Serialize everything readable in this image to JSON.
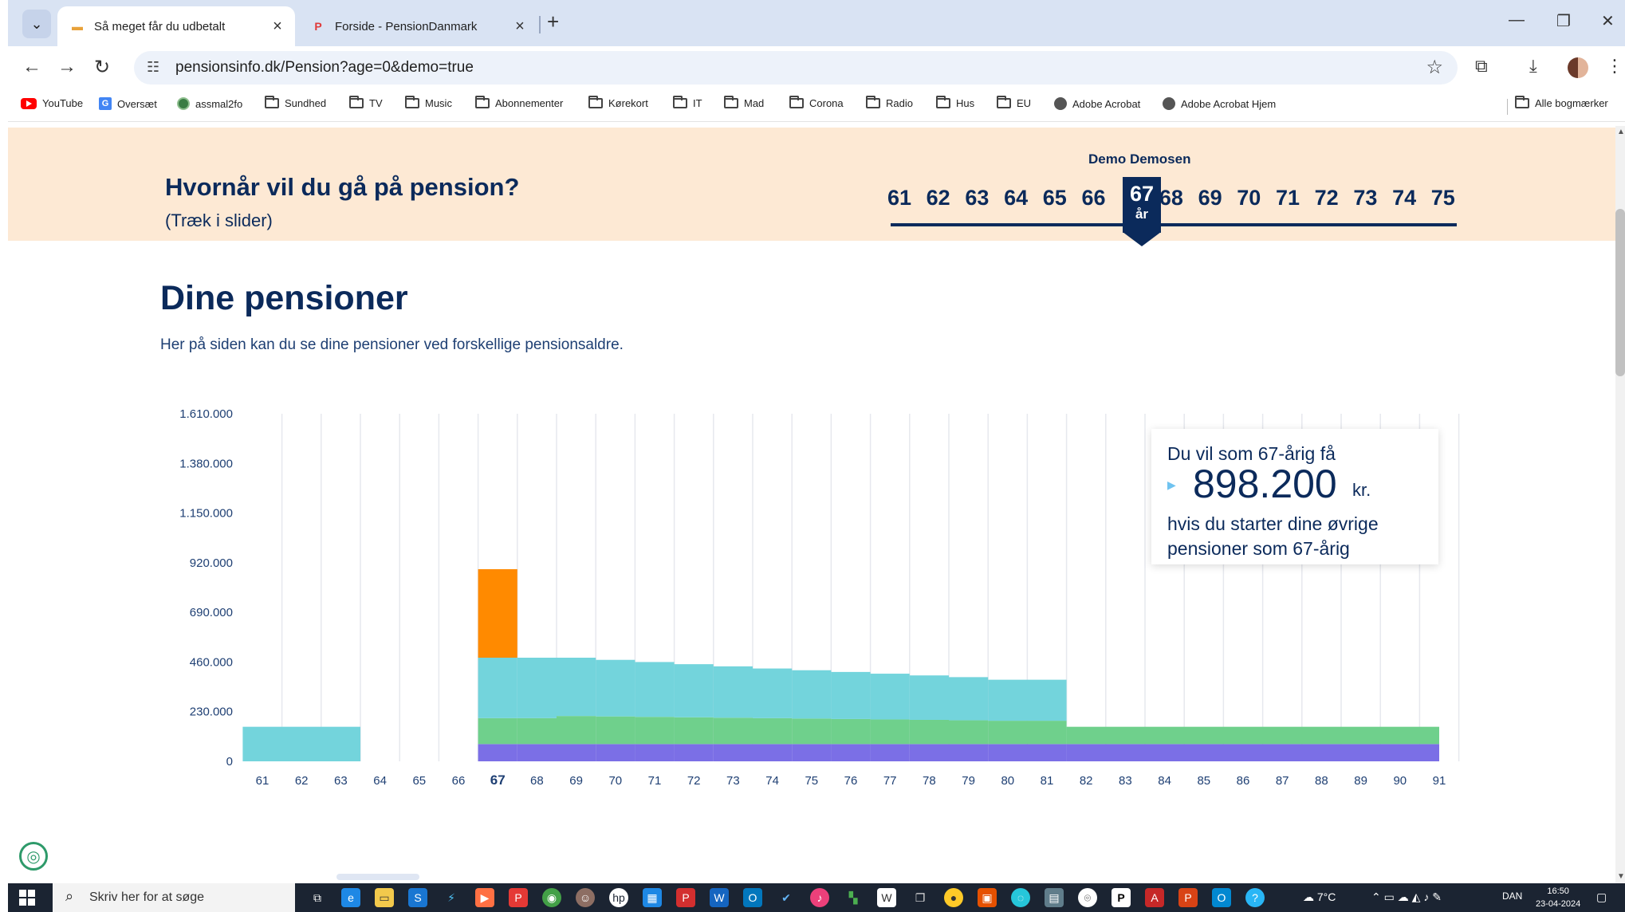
{
  "browser": {
    "tabs": [
      {
        "title": "Så meget får du udbetalt",
        "active": true
      },
      {
        "title": "Forside - PensionDanmark",
        "active": false
      }
    ],
    "new_tab_label": "+",
    "url": "pensionsinfo.dk/Pension?age=0&demo=true",
    "bookmarks": [
      "YouTube",
      "Oversæt",
      "assmal2fo",
      "Sundhed",
      "TV",
      "Music",
      "Abonnementer",
      "Kørekort",
      "IT",
      "Mad",
      "Corona",
      "Radio",
      "Hus",
      "EU",
      "Adobe Acrobat",
      "Adobe Acrobat Hjem"
    ],
    "all_bookmarks": "Alle bogmærker"
  },
  "banner": {
    "question": "Hvornår vil du gå på pension?",
    "hint": "(Træk i slider)",
    "user_name": "Demo Demosen",
    "ages": [
      "61",
      "62",
      "63",
      "64",
      "65",
      "66",
      "67",
      "68",
      "69",
      "70",
      "71",
      "72",
      "73",
      "74",
      "75"
    ],
    "selected_age": "67",
    "selected_unit": "år"
  },
  "main": {
    "title": "Dine pensioner",
    "intro": "Her på siden kan du se dine pensioner ved forskellige pensionsaldre."
  },
  "tooltip": {
    "line1": "Du vil som 67-årig få",
    "amount": "898.200",
    "unit": "kr.",
    "line2": "hvis du starter dine øvrige pensioner som 67-årig"
  },
  "chart_data": {
    "type": "area",
    "y_ticks": [
      "1.610.000",
      "1.380.000",
      "1.150.000",
      "920.000",
      "690.000",
      "460.000",
      "230.000",
      "0"
    ],
    "ylim": [
      0,
      1610000
    ],
    "x_ticks": [
      "61",
      "62",
      "63",
      "64",
      "65",
      "66",
      "67",
      "68",
      "69",
      "70",
      "71",
      "72",
      "73",
      "74",
      "75",
      "76",
      "77",
      "78",
      "79",
      "80",
      "81",
      "82",
      "83",
      "84",
      "85",
      "86",
      "87",
      "88",
      "89",
      "90",
      "91"
    ],
    "highlight_tick": "67",
    "colors": {
      "purple": "#7b6fe6",
      "green": "#6fd08c",
      "cyan": "#73d4dc",
      "orange": "#ff8a00"
    },
    "segments": [
      {
        "from": "61",
        "to": "64",
        "purple": 0,
        "green": 0,
        "cyan": 160000,
        "orange": 0
      },
      {
        "from": "67",
        "to": "68",
        "purple": 80000,
        "green": 120000,
        "cyan": 280000,
        "orange": 410000
      },
      {
        "from": "68",
        "to": "69",
        "purple": 80000,
        "green": 120000,
        "cyan": 280000,
        "orange": 0
      },
      {
        "from": "69",
        "to": "70",
        "purple": 80000,
        "green": 130000,
        "cyan": 270000,
        "orange": 0
      },
      {
        "from": "70",
        "to": "71",
        "purple": 80000,
        "green": 128000,
        "cyan": 262000,
        "orange": 0
      },
      {
        "from": "71",
        "to": "72",
        "purple": 80000,
        "green": 126000,
        "cyan": 254000,
        "orange": 0
      },
      {
        "from": "72",
        "to": "73",
        "purple": 80000,
        "green": 124000,
        "cyan": 246000,
        "orange": 0
      },
      {
        "from": "73",
        "to": "74",
        "purple": 80000,
        "green": 122000,
        "cyan": 238000,
        "orange": 0
      },
      {
        "from": "74",
        "to": "75",
        "purple": 80000,
        "green": 120000,
        "cyan": 230000,
        "orange": 0
      },
      {
        "from": "75",
        "to": "76",
        "purple": 80000,
        "green": 118000,
        "cyan": 224000,
        "orange": 0
      },
      {
        "from": "76",
        "to": "77",
        "purple": 80000,
        "green": 116000,
        "cyan": 218000,
        "orange": 0
      },
      {
        "from": "77",
        "to": "78",
        "purple": 80000,
        "green": 114000,
        "cyan": 212000,
        "orange": 0
      },
      {
        "from": "78",
        "to": "79",
        "purple": 80000,
        "green": 112000,
        "cyan": 206000,
        "orange": 0
      },
      {
        "from": "79",
        "to": "80",
        "purple": 80000,
        "green": 110000,
        "cyan": 200000,
        "orange": 0
      },
      {
        "from": "80",
        "to": "82",
        "purple": 80000,
        "green": 108000,
        "cyan": 190000,
        "orange": 0
      },
      {
        "from": "82",
        "to": "91.5",
        "purple": 80000,
        "green": 80000,
        "cyan": 0,
        "orange": 0
      }
    ]
  },
  "taskbar": {
    "search_placeholder": "Skriv her for at søge",
    "weather": "7°C",
    "language": "DAN",
    "time": "16:50",
    "date": "23-04-2024"
  }
}
